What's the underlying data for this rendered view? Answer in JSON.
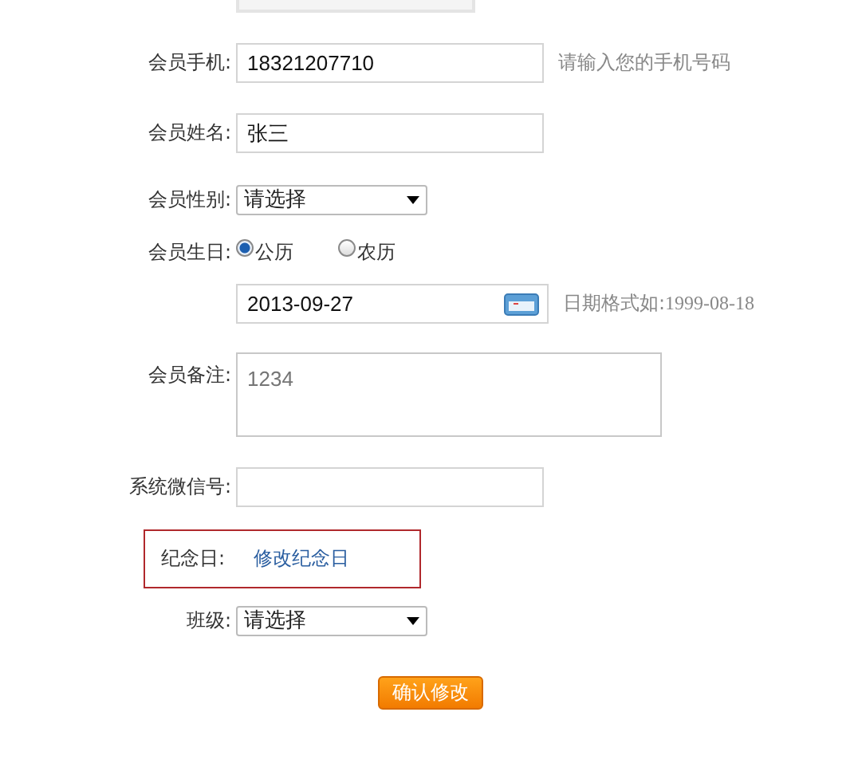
{
  "fields": [
    {
      "kind": "text",
      "label": "会员手机:",
      "value": "18321207710",
      "hint": "请输入您的手机号码"
    },
    {
      "kind": "text",
      "label": "会员姓名:",
      "value": "张三"
    },
    {
      "kind": "select",
      "label": "会员性别:",
      "value": "请选择"
    },
    {
      "kind": "radio",
      "label": "会员生日:",
      "options": [
        {
          "label": "公历",
          "selected": true
        },
        {
          "label": "农历",
          "selected": false
        }
      ]
    },
    {
      "kind": "date",
      "value": "2013-09-27",
      "hint": "日期格式如:",
      "hint_example": "1999-08-18"
    },
    {
      "kind": "textarea",
      "label": "会员备注:",
      "placeholder": "1234"
    },
    {
      "kind": "text",
      "label": "系统微信号:"
    },
    {
      "kind": "link",
      "label": "纪念日:",
      "link": "修改纪念日"
    },
    {
      "kind": "select",
      "label": "班级:",
      "value": "请选择"
    }
  ],
  "submit": "确认修改"
}
